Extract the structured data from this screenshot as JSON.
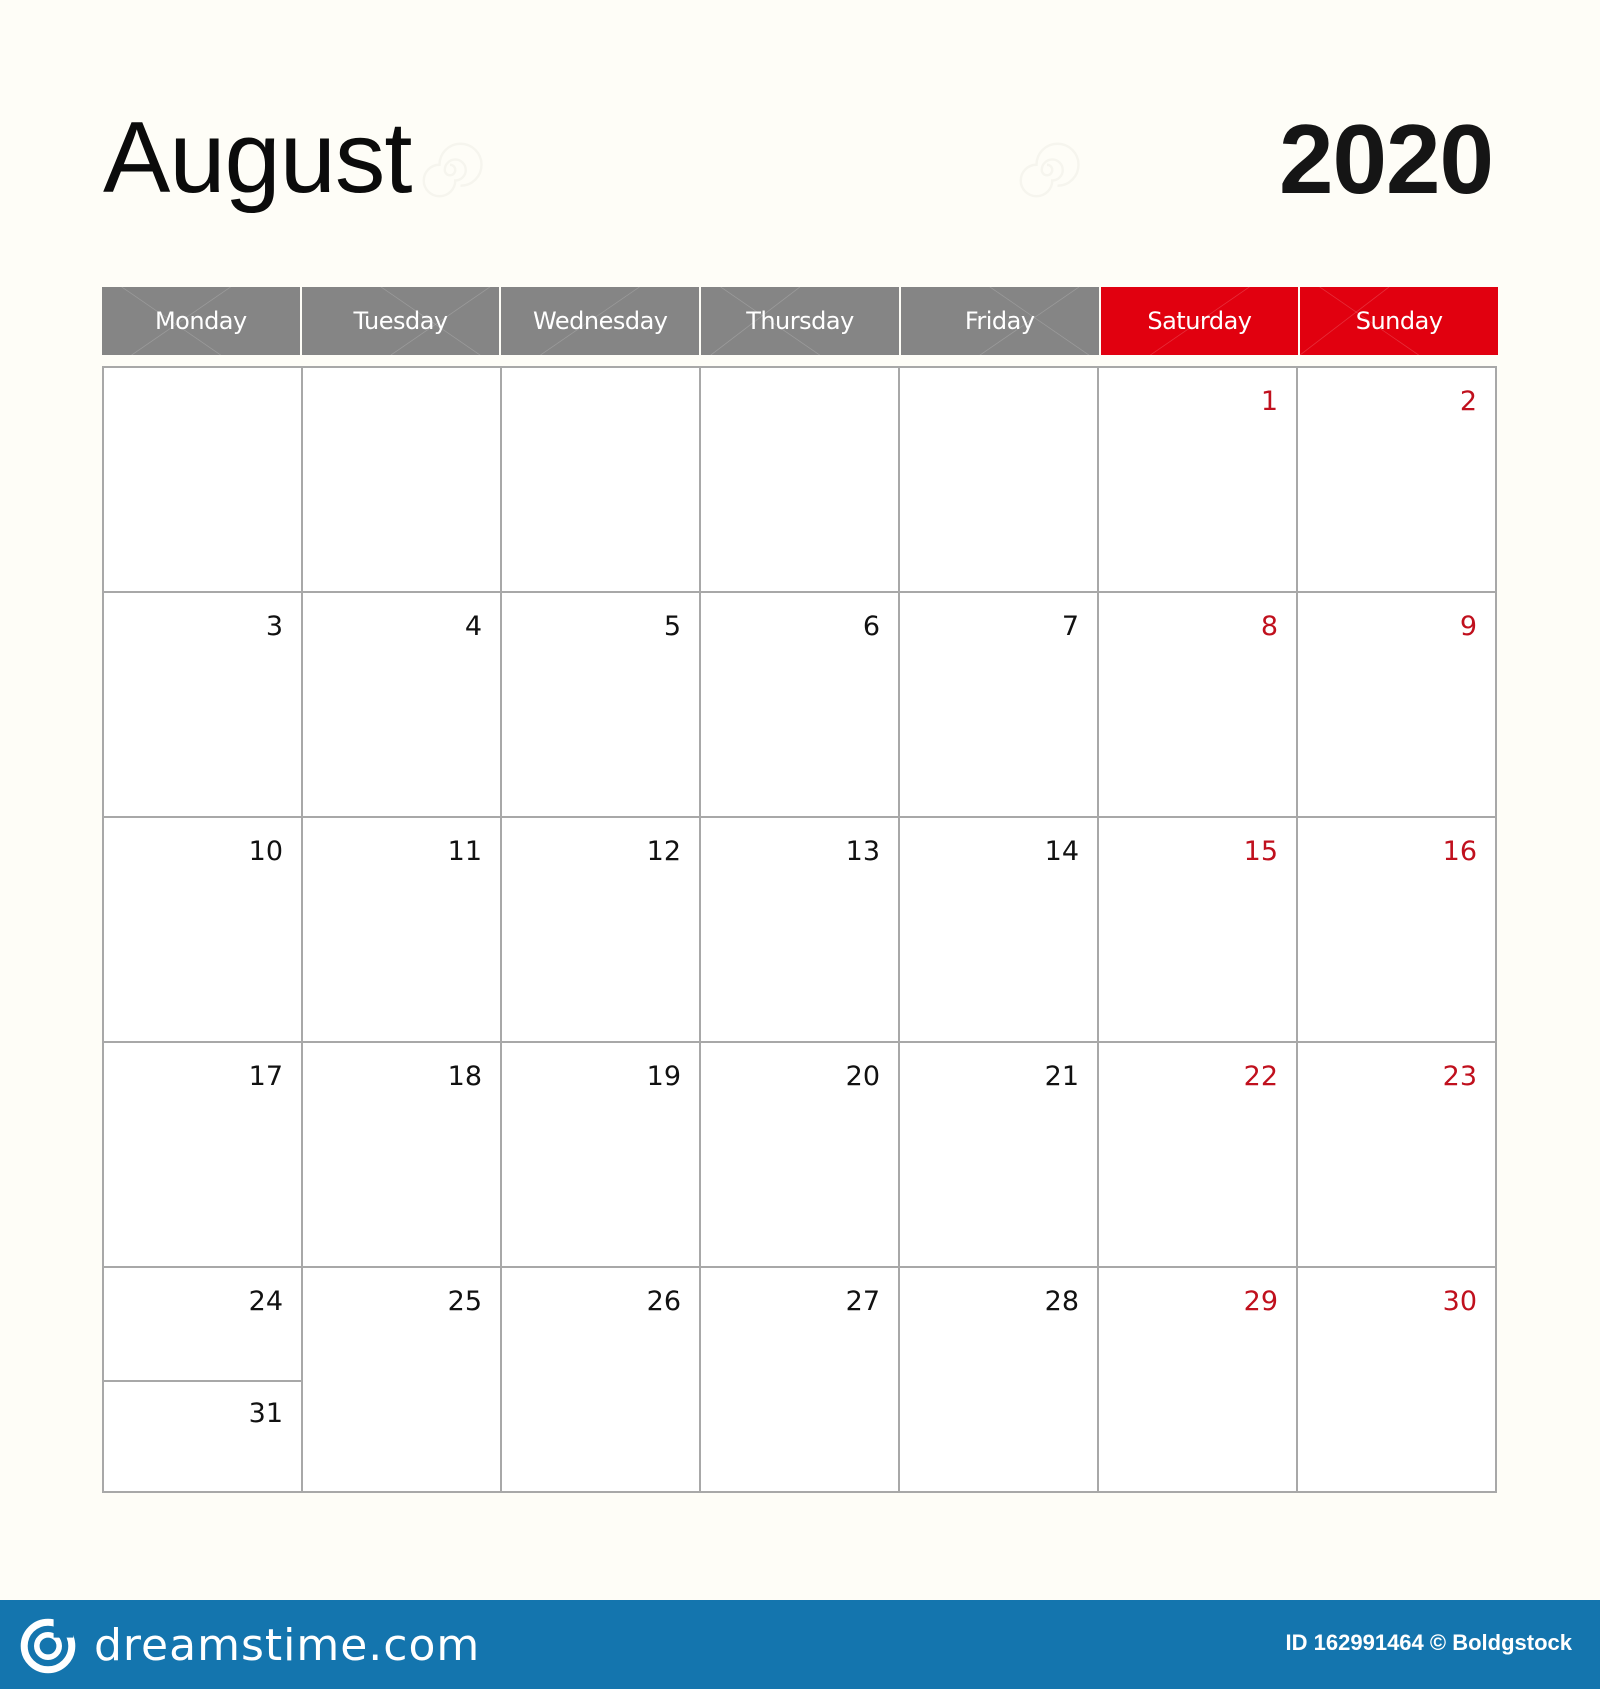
{
  "calendar": {
    "month": "August",
    "year": "2020",
    "weekdays": [
      {
        "label": "Monday",
        "weekend": false
      },
      {
        "label": "Tuesday",
        "weekend": false
      },
      {
        "label": "Wednesday",
        "weekend": false
      },
      {
        "label": "Thursday",
        "weekend": false
      },
      {
        "label": "Friday",
        "weekend": false
      },
      {
        "label": "Saturday",
        "weekend": true
      },
      {
        "label": "Sunday",
        "weekend": true
      }
    ],
    "weeks": [
      [
        "",
        "",
        "",
        "",
        "",
        "1",
        "2"
      ],
      [
        "3",
        "4",
        "5",
        "6",
        "7",
        "8",
        "9"
      ],
      [
        "10",
        "11",
        "12",
        "13",
        "14",
        "15",
        "16"
      ],
      [
        "17",
        "18",
        "19",
        "20",
        "21",
        "22",
        "23"
      ],
      [
        "24",
        "25",
        "26",
        "27",
        "28",
        "29",
        "30"
      ]
    ],
    "split_cell_extra": "31",
    "colors": {
      "weekday_header": "#858585",
      "weekend_header": "#e1000f",
      "weekend_number": "#c0101d",
      "grid_line": "#a8a8a8"
    }
  },
  "footer": {
    "brand": "dreamstime.com",
    "credit": "ID 162991464 © Boldgstock",
    "background": "#1475ae"
  }
}
